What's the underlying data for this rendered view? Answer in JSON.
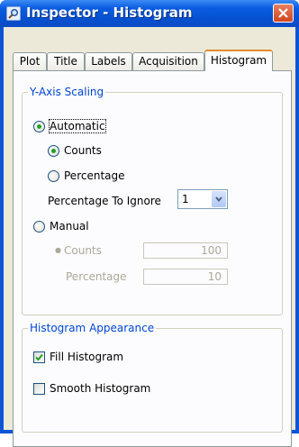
{
  "window": {
    "title": "Inspector - Histogram"
  },
  "tabs": [
    {
      "label": "Plot"
    },
    {
      "label": "Title"
    },
    {
      "label": "Labels"
    },
    {
      "label": "Acquisition"
    },
    {
      "label": "Histogram",
      "active": true
    }
  ],
  "y_axis_scaling": {
    "legend": "Y-Axis Scaling",
    "automatic_label": "Automatic",
    "counts_label": "Counts",
    "percentage_label": "Percentage",
    "percentage_to_ignore_label": "Percentage To Ignore",
    "percentage_to_ignore_value": "1",
    "manual_label": "Manual",
    "manual_counts_label": "Counts",
    "manual_counts_value": "100",
    "manual_percentage_label": "Percentage",
    "manual_percentage_value": "10",
    "selected_mode": "Automatic",
    "selected_unit": "Counts"
  },
  "histogram_appearance": {
    "legend": "Histogram Appearance",
    "fill_label": "Fill Histogram",
    "fill_checked": true,
    "smooth_label": "Smooth Histogram",
    "smooth_checked": false
  },
  "colors": {
    "titlebar": "#0a5ce0",
    "group_legend": "#0046d5",
    "radio_dot": "#21a121",
    "tab_highlight": "#e68b2c"
  },
  "icons": {
    "app": "inspector-magnifier-icon",
    "close": "close-x-icon",
    "dropdown": "chevron-down-icon",
    "check": "checkmark-icon"
  }
}
